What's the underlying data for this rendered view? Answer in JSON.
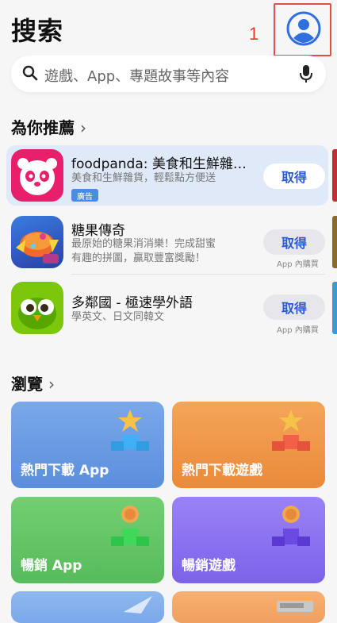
{
  "page_title": "搜索",
  "annotation": {
    "number": "1"
  },
  "search": {
    "placeholder": "遊戲、App、專題故事等內容"
  },
  "recommend": {
    "title": "為你推薦",
    "chevron": "›"
  },
  "apps": [
    {
      "name": "foodpanda: 美食和生鮮雜…",
      "desc": "美食和生鮮雜貨，輕鬆點方便送",
      "badge": "廣告",
      "button": "取得"
    },
    {
      "name": "糖果傳奇",
      "desc_line1": "最原始的糖果消消樂！完成甜蜜",
      "desc_line2": "有趣的拼圖，贏取豐富獎勵！",
      "button": "取得",
      "iap": "App 內購買"
    },
    {
      "name": "多鄰國 - 極速學外語",
      "desc": "學英文、日文同韓文",
      "button": "取得",
      "iap": "App 內購買"
    }
  ],
  "browse": {
    "title": "瀏覽",
    "chevron": "›",
    "tiles": [
      {
        "label": "熱門下載 App",
        "color": "#6c9fe3"
      },
      {
        "label": "熱門下載遊戲",
        "color": "#ee9145"
      },
      {
        "label": "暢銷 App",
        "color": "#62c667"
      },
      {
        "label": "暢銷遊戲",
        "color": "#8a6ff0"
      }
    ]
  },
  "colors": {
    "accent": "#2a5ad8",
    "annotation": "#e64a4a"
  },
  "icons": [
    "avatar-icon",
    "search-icon",
    "mic-icon",
    "foodpanda-icon",
    "candy-crush-icon",
    "duolingo-icon",
    "star-icon"
  ]
}
